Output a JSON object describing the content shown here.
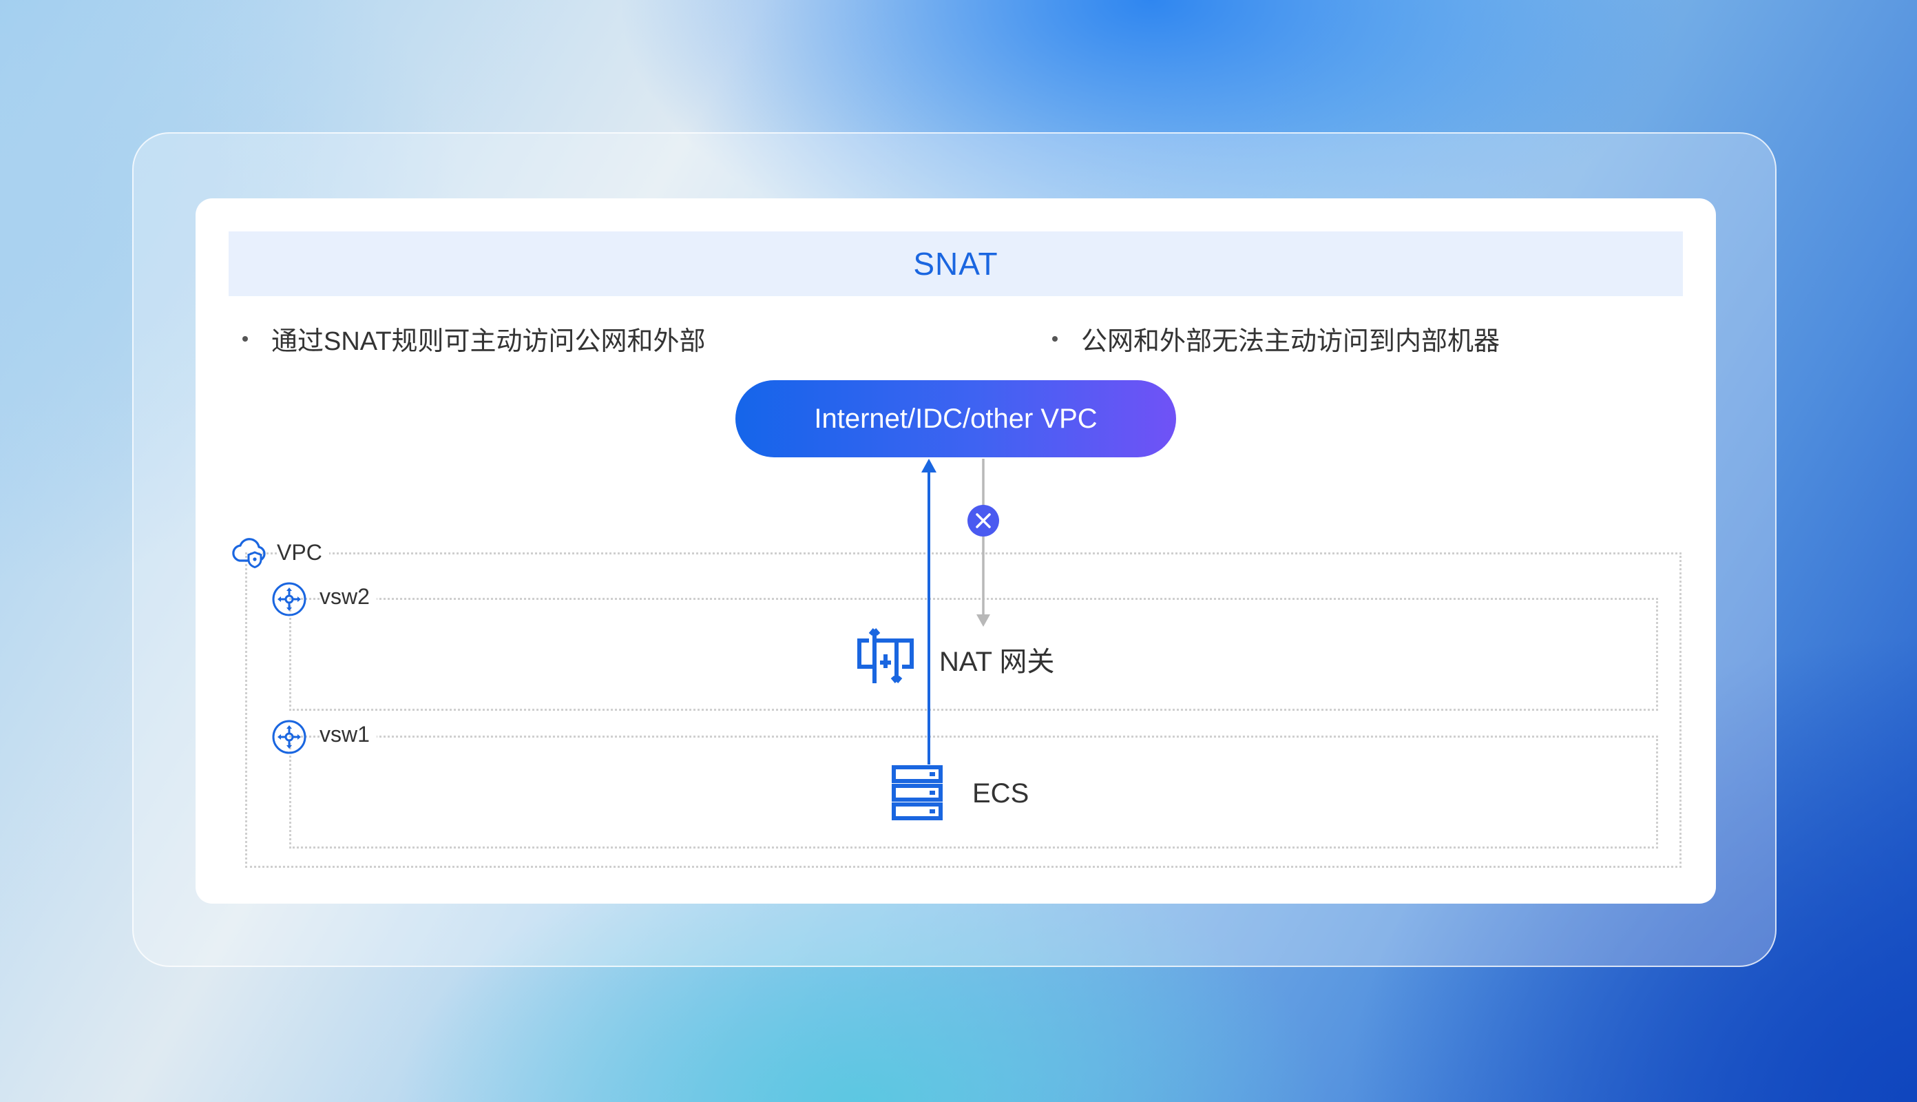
{
  "header": {
    "title": "SNAT"
  },
  "bullets": {
    "left": "通过SNAT规则可主动访问公网和外部",
    "right": "公网和外部无法主动访问到内部机器"
  },
  "external": {
    "label": "Internet/IDC/other VPC"
  },
  "vpc": {
    "label": "VPC",
    "icon": "cloud-shield-icon"
  },
  "vsw2": {
    "label": "vsw2",
    "icon": "switch-icon"
  },
  "vsw1": {
    "label": "vsw1",
    "icon": "switch-icon"
  },
  "nat": {
    "label": "NAT 网关",
    "icon": "nat-gateway-icon"
  },
  "ecs": {
    "label": "ECS",
    "icon": "server-icon"
  },
  "colors": {
    "accent": "#1a66e0",
    "pill_start": "#1565ea",
    "pill_end": "#7052f6",
    "blocked_arrow": "#b8b8b8",
    "block_marker": "#4a5af0"
  }
}
